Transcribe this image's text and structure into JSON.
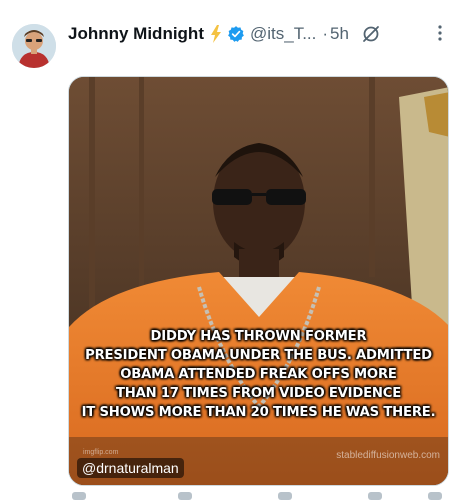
{
  "author": {
    "name": "Johnny Midnight",
    "handle": "@its_T...",
    "separator": "·",
    "time": "5h",
    "icons": [
      "lightning-bolt-icon",
      "verified-badge-icon",
      "grok-icon",
      "more-options-icon"
    ]
  },
  "media": {
    "caption_lines": [
      "DIDDY HAS THROWN FORMER",
      "PRESIDENT OBAMA UNDER THE BUS. ADMITTED",
      "OBAMA ATTENDED FREAK OFFS MORE",
      "THAN 17 TIMES FROM VIDEO EVIDENCE",
      "IT SHOWS MORE THAN 20 TIMES HE WAS THERE."
    ],
    "credit": "@drnaturalman",
    "watermark": "stablediffusionweb.com",
    "watermark_small": "imgflip.com"
  },
  "colors": {
    "verified": "#1d9bf0",
    "bolt": "#f4c242",
    "secondary_text": "#536471",
    "jumpsuit": "#e07a2a"
  }
}
